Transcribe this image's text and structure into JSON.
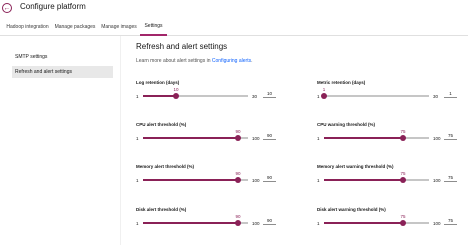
{
  "header": {
    "title": "Configure platform"
  },
  "tabs": [
    {
      "label": "Hadoop integration"
    },
    {
      "label": "Manage packages"
    },
    {
      "label": "Manage images"
    },
    {
      "label": "Settings"
    }
  ],
  "sidebar": {
    "items": [
      {
        "label": "SMTP settings"
      },
      {
        "label": "Refresh and alert settings"
      }
    ]
  },
  "main": {
    "heading": "Refresh and alert settings",
    "learn_text": "Learn more about alert settings in",
    "learn_link": "Configuring alerts",
    "learn_end": ".",
    "fields": [
      {
        "label": "Log retention (days)",
        "min": "1",
        "max": "30",
        "value": "10",
        "fraction": 0.31
      },
      {
        "label": "Metric retention (days)",
        "min": "1",
        "max": "30",
        "value": "1",
        "fraction": 0.0
      },
      {
        "label": "CPU alert threshold (%)",
        "min": "1",
        "max": "100",
        "value": "90",
        "fraction": 0.9
      },
      {
        "label": "CPU warning threshold (%)",
        "min": "1",
        "max": "100",
        "value": "75",
        "fraction": 0.75
      },
      {
        "label": "Memory alert threshold (%)",
        "min": "1",
        "max": "100",
        "value": "90",
        "fraction": 0.9
      },
      {
        "label": "Memory alert warning threshold (%)",
        "min": "1",
        "max": "100",
        "value": "75",
        "fraction": 0.75
      },
      {
        "label": "Disk alert threshold (%)",
        "min": "1",
        "max": "100",
        "value": "90",
        "fraction": 0.9
      },
      {
        "label": "Disk alert warning threshold (%)",
        "min": "1",
        "max": "100",
        "value": "75",
        "fraction": 0.75
      }
    ]
  }
}
